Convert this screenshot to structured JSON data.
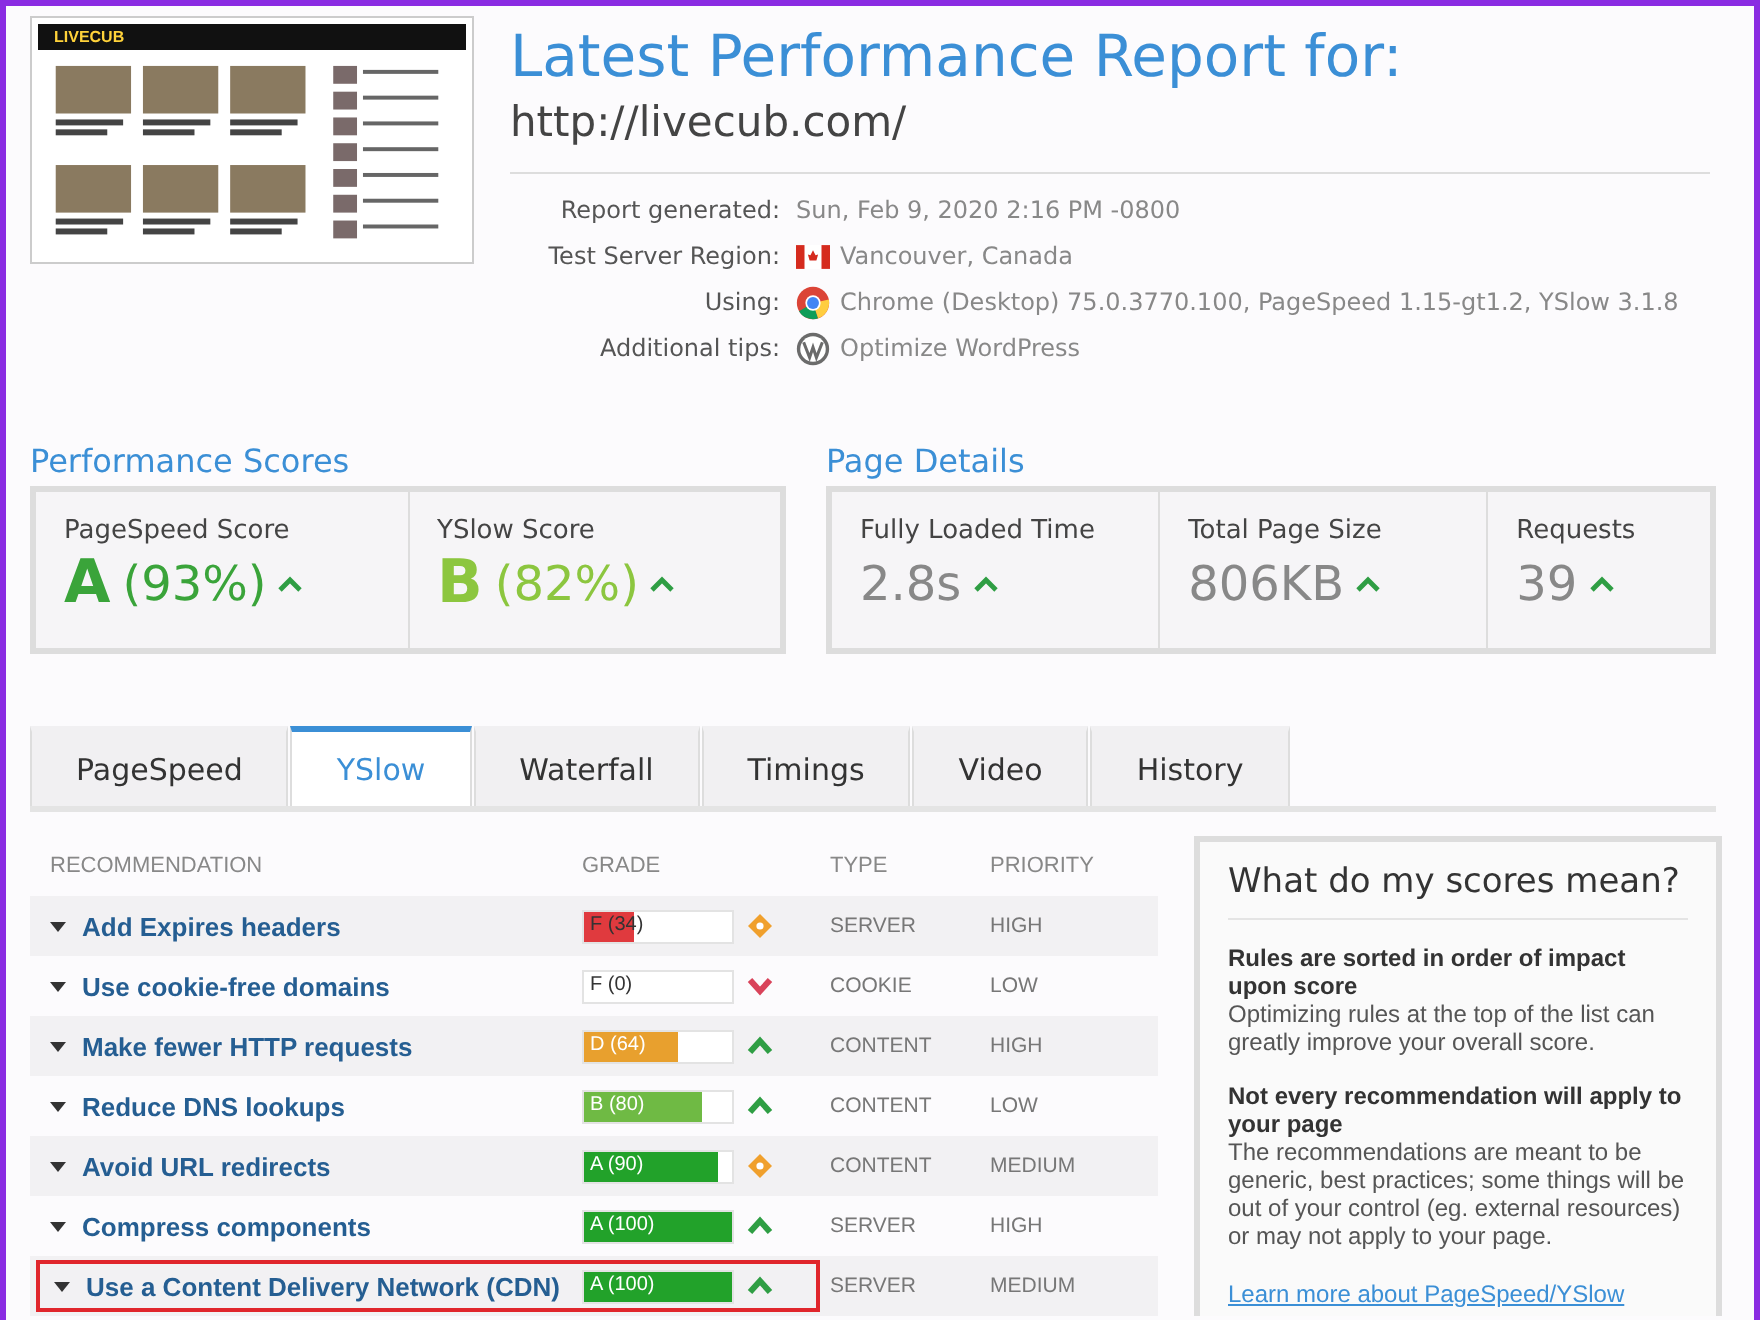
{
  "thumbnail": {
    "logo": "LIVECUB"
  },
  "header": {
    "title": "Latest Performance Report for:",
    "url": "http://livecub.com/"
  },
  "info": [
    {
      "kind": "plain",
      "label": "Report generated:",
      "value": "Sun, Feb 9, 2020 2:16 PM -0800"
    },
    {
      "kind": "flag",
      "label": "Test Server Region:",
      "value": "Vancouver, Canada"
    },
    {
      "kind": "browser",
      "label": "Using:",
      "value": "Chrome (Desktop) 75.0.3770.100, PageSpeed 1.15-gt1.2, YSlow 3.1.8"
    },
    {
      "kind": "wordpress",
      "label": "Additional tips:",
      "value": "Optimize WordPress"
    }
  ],
  "performance_scores": {
    "heading": "Performance Scores",
    "items": [
      {
        "label": "PageSpeed Score",
        "grade": "A",
        "percent": "(93%)",
        "color": "#3aa43a"
      },
      {
        "label": "YSlow Score",
        "grade": "B",
        "percent": "(82%)",
        "color": "#8cc63f"
      }
    ]
  },
  "page_details": {
    "heading": "Page Details",
    "items": [
      {
        "label": "Fully Loaded Time",
        "value": "2.8s"
      },
      {
        "label": "Total Page Size",
        "value": "806KB"
      },
      {
        "label": "Requests",
        "value": "39"
      }
    ]
  },
  "tabs": [
    {
      "label": "PageSpeed",
      "selected": false
    },
    {
      "label": "YSlow",
      "selected": true
    },
    {
      "label": "Waterfall",
      "selected": false
    },
    {
      "label": "Timings",
      "selected": false
    },
    {
      "label": "Video",
      "selected": false
    },
    {
      "label": "History",
      "selected": false
    }
  ],
  "table": {
    "columns": [
      "RECOMMENDATION",
      "GRADE",
      "TYPE",
      "PRIORITY"
    ],
    "rows": [
      {
        "name": "Add Expires headers",
        "grade": "F (34)",
        "level": 0.34,
        "color": "#e03a3e",
        "kind": "diamond",
        "type": "SERVER",
        "priority": "HIGH",
        "highlighted": false
      },
      {
        "name": "Use cookie-free domains",
        "grade": "F (0)",
        "kind": "down",
        "type": "COOKIE",
        "priority": "LOW",
        "highlighted": false
      },
      {
        "name": "Make fewer HTTP requests",
        "grade": "D (64)",
        "level": 0.64,
        "color": "#e8a02e",
        "kind": "up",
        "type": "CONTENT",
        "priority": "HIGH",
        "highlighted": false
      },
      {
        "name": "Reduce DNS lookups",
        "grade": "B (80)",
        "level": 0.8,
        "color": "#6fba44",
        "kind": "up",
        "type": "CONTENT",
        "priority": "LOW",
        "highlighted": false
      },
      {
        "name": "Avoid URL redirects",
        "grade": "A (90)",
        "level": 0.9,
        "color": "#22a22a",
        "kind": "diamond",
        "type": "CONTENT",
        "priority": "MEDIUM",
        "highlighted": false
      },
      {
        "name": "Compress components",
        "grade": "A (100)",
        "level": 1,
        "color": "#22a22a",
        "kind": "up",
        "type": "SERVER",
        "priority": "HIGH",
        "highlighted": false
      },
      {
        "name": "Use a Content Delivery Network (CDN)",
        "grade": "A (100)",
        "level": 1,
        "color": "#22a22a",
        "kind": "up",
        "type": "SERVER",
        "priority": "MEDIUM",
        "highlighted": true
      }
    ]
  },
  "help": {
    "title": "What do my scores mean?",
    "sections": [
      {
        "heading": "Rules are sorted in order of impact upon score",
        "text": "Optimizing rules at the top of the list can greatly improve your overall score."
      },
      {
        "heading": "Not every recommendation will apply to your page",
        "text": "The recommendations are meant to be generic, best practices; some things will be out of your control (eg. external resources) or may not apply to your page."
      }
    ],
    "link": "Learn more about PageSpeed/YSlow"
  }
}
